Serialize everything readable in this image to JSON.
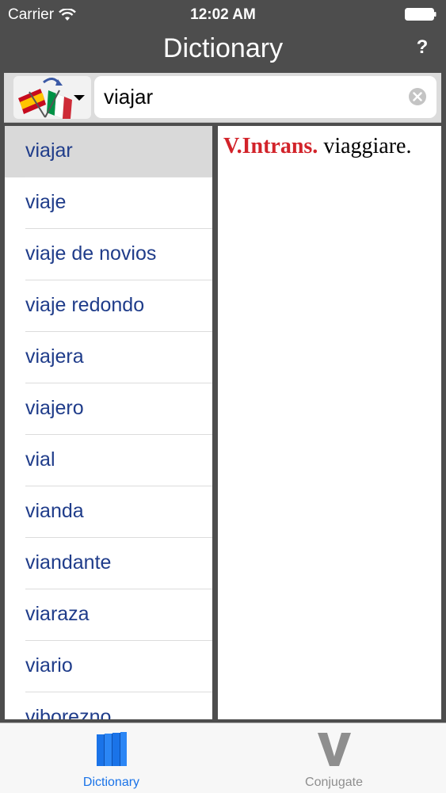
{
  "status": {
    "carrier": "Carrier",
    "time": "12:02 AM"
  },
  "nav": {
    "title": "Dictionary",
    "help": "?"
  },
  "search": {
    "language_icon": "spain-italy-flags-icon",
    "value": "viajar"
  },
  "results": [
    {
      "label": "viajar",
      "selected": true
    },
    {
      "label": "viaje"
    },
    {
      "label": "viaje de novios"
    },
    {
      "label": "viaje redondo"
    },
    {
      "label": "viajera"
    },
    {
      "label": "viajero"
    },
    {
      "label": "vial"
    },
    {
      "label": "vianda"
    },
    {
      "label": "viandante"
    },
    {
      "label": "viaraza"
    },
    {
      "label": "viario"
    },
    {
      "label": "viborezno"
    }
  ],
  "definition": {
    "pos": "V.Intrans.",
    "meaning": " viaggiare."
  },
  "tabs": {
    "dictionary": "Dictionary",
    "conjugate": "Conjugate"
  },
  "colors": {
    "accent": "#1a73e8",
    "pos": "#d2232a",
    "list_text": "#1f3c8a",
    "bar": "#4d4d4d"
  }
}
